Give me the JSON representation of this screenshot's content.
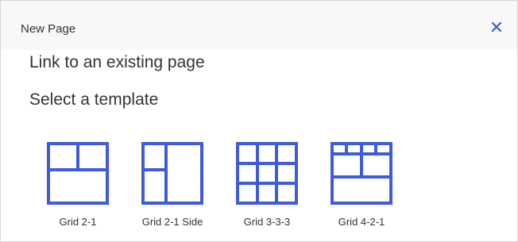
{
  "dialog": {
    "title": "New Page",
    "close_icon": "close-icon",
    "accent_color": "#3f5bd9"
  },
  "link_existing": "Link to an existing page",
  "select_heading": "Select a template",
  "templates": [
    {
      "label": "Grid 2-1",
      "icon": "grid-2-1-icon"
    },
    {
      "label": "Grid 2-1 Side",
      "icon": "grid-2-1-side-icon"
    },
    {
      "label": "Grid 3-3-3",
      "icon": "grid-3-3-3-icon"
    },
    {
      "label": "Grid 4-2-1",
      "icon": "grid-4-2-1-icon"
    }
  ]
}
